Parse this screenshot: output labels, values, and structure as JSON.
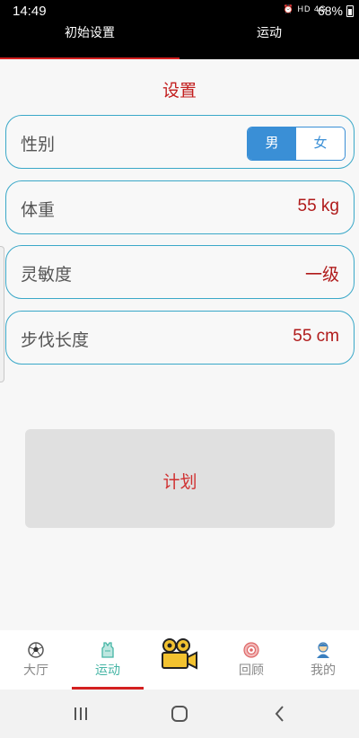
{
  "status": {
    "time": "14:49",
    "indicators": "⏰ HD 4G",
    "battery": "68%"
  },
  "top_tabs": [
    {
      "label": "初始设置",
      "active": true
    },
    {
      "label": "运动",
      "active": false
    }
  ],
  "title": "设置",
  "rows": {
    "gender": {
      "label": "性别",
      "options": [
        "男",
        "女"
      ],
      "selected": "男"
    },
    "weight": {
      "label": "体重",
      "value": "55 kg"
    },
    "sensitivity": {
      "label": "灵敏度",
      "value": "一级"
    },
    "stride": {
      "label": "步伐长度",
      "value": "55 cm"
    }
  },
  "plan_button": "计划",
  "bottom_nav": [
    {
      "label": "大厅",
      "icon": "soccer-ball-icon",
      "active": false
    },
    {
      "label": "运动",
      "icon": "sport-vest-icon",
      "active": true
    },
    {
      "label": "",
      "icon": "video-camera-icon",
      "active": false
    },
    {
      "label": "回顾",
      "icon": "target-icon",
      "active": false
    },
    {
      "label": "我的",
      "icon": "user-avatar-icon",
      "active": false
    }
  ],
  "system_nav": [
    "recent-apps-icon",
    "home-icon",
    "back-icon"
  ],
  "colors": {
    "accent_red": "#c21d1d",
    "border_teal": "#3aa8c8",
    "toggle_blue": "#3a8fd6",
    "active_nav": "#45b5a5"
  }
}
